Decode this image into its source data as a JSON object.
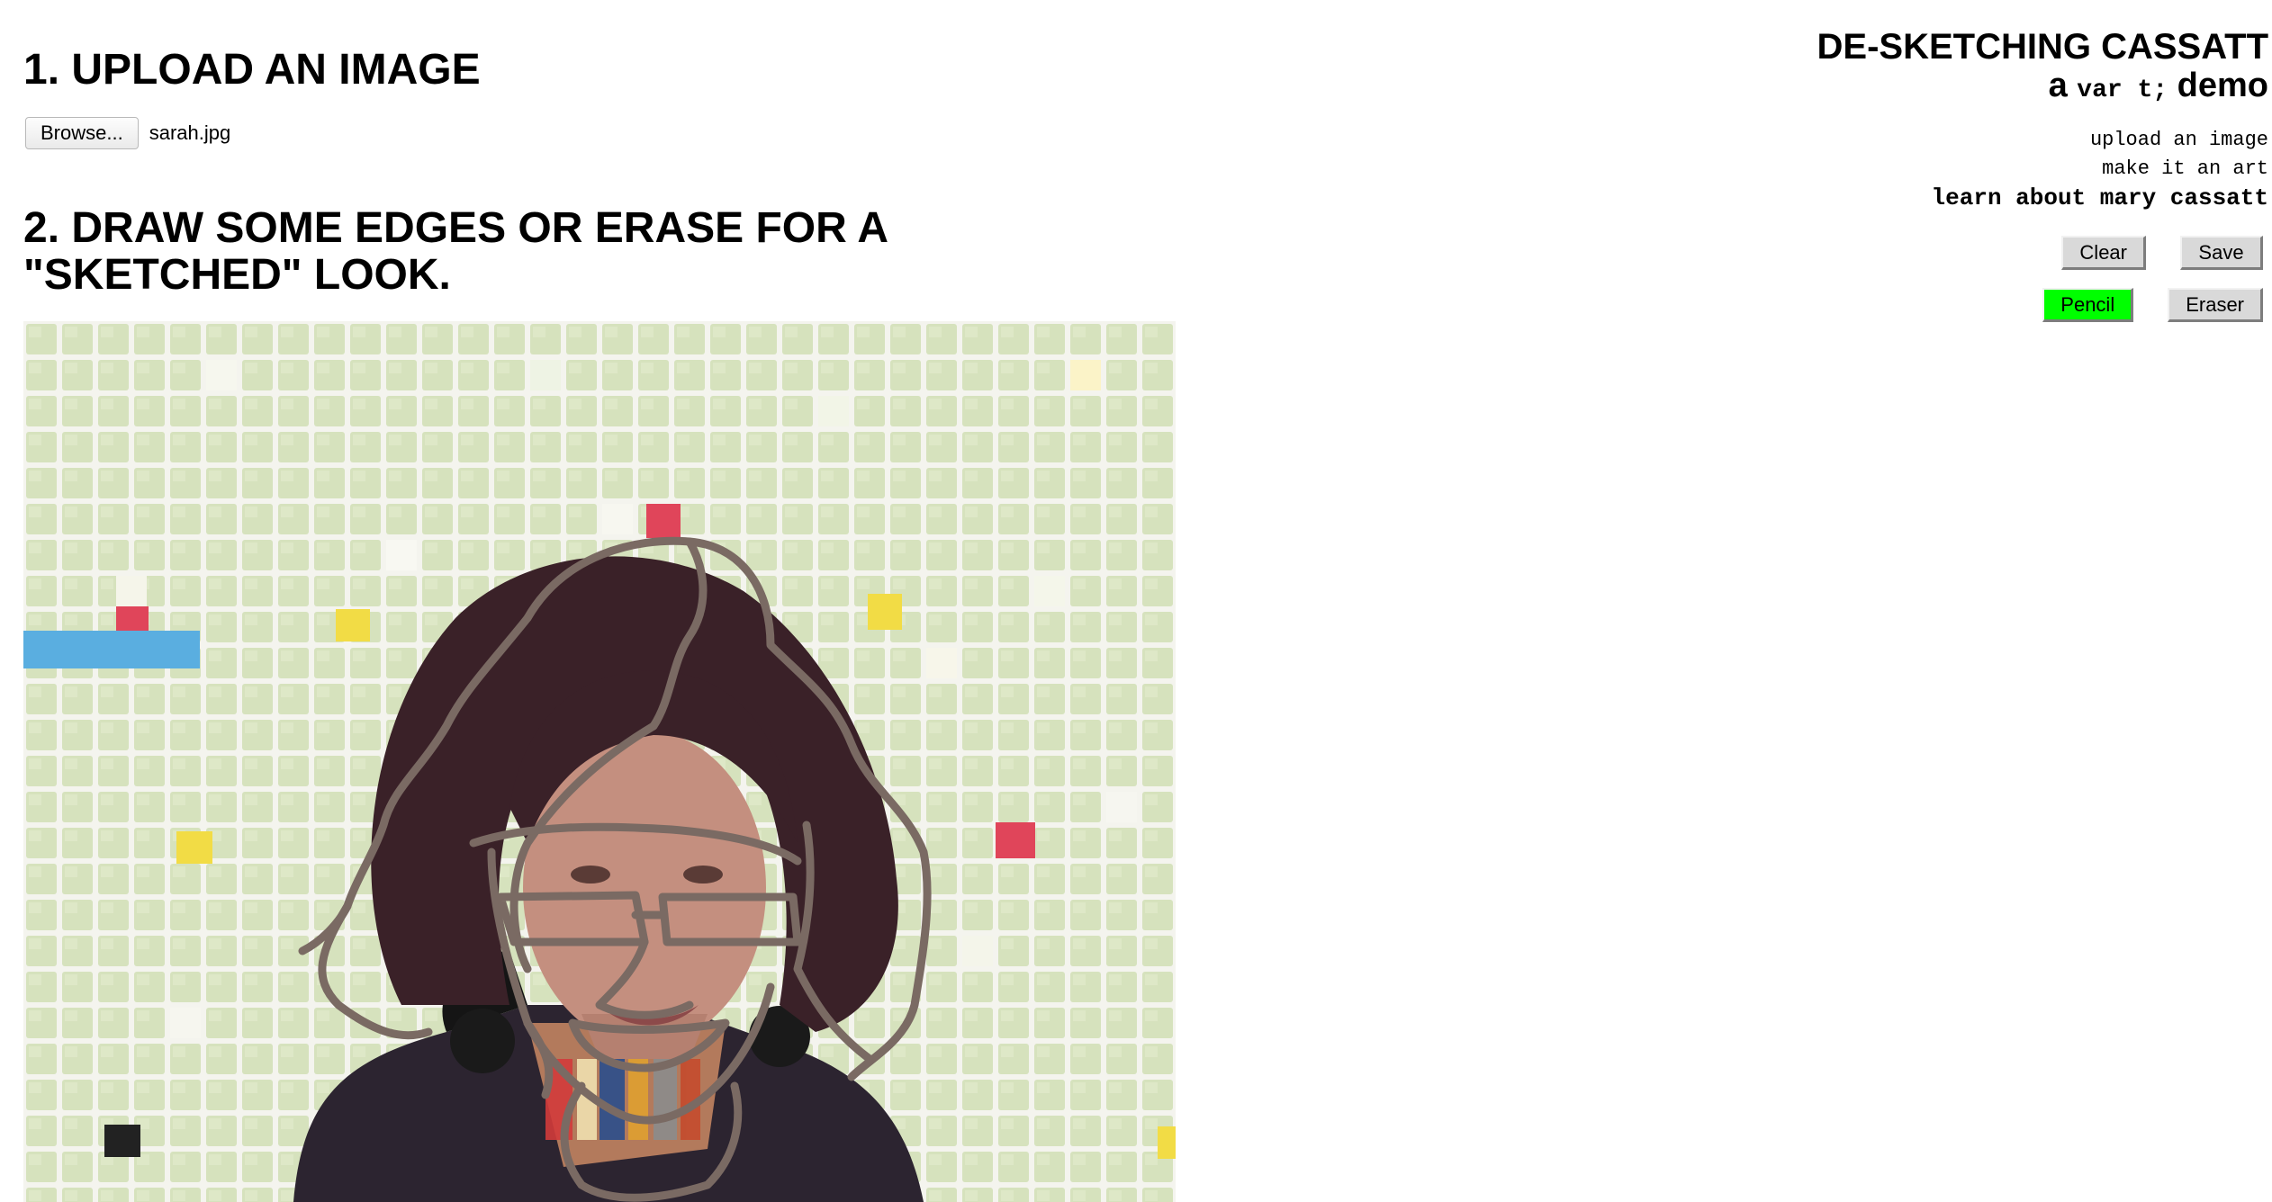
{
  "step1": {
    "title": "1. Upload an image",
    "browse_label": "Browse...",
    "file_name": "sarah.jpg"
  },
  "step2": {
    "title": "2. Draw some edges or erase for a \"sketched\" look."
  },
  "header": {
    "app_title": "De-sketching Cassatt",
    "sub_prefix": "a ",
    "sub_mono": "var t;",
    "sub_suffix": " demo"
  },
  "nav": {
    "items": [
      {
        "label": "upload an image"
      },
      {
        "label": "make it an art"
      },
      {
        "label": "learn about mary cassatt"
      }
    ]
  },
  "tools": {
    "clear_label": "Clear",
    "save_label": "Save",
    "pencil_label": "Pencil",
    "eraser_label": "Eraser",
    "active_tool": "pencil",
    "active_color": "#00ff00",
    "stroke_color": "#7a6a63"
  }
}
